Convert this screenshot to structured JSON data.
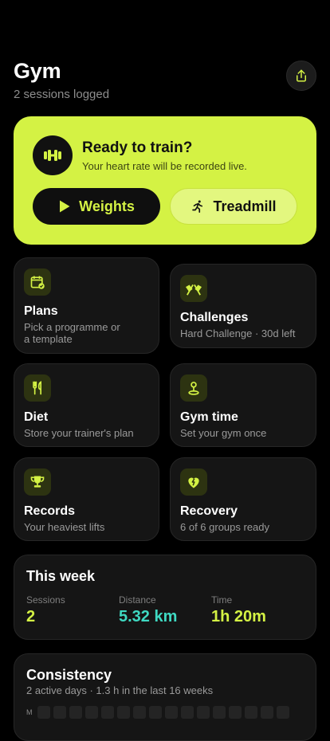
{
  "header": {
    "title": "Gym",
    "subtitle": "2 sessions logged",
    "share_icon": "share-icon"
  },
  "hero": {
    "icon": "dumbbell-icon",
    "title": "Ready to train?",
    "subtitle": "Your heart rate will be recorded live.",
    "weights_label": "Weights",
    "treadmill_label": "Treadmill"
  },
  "tiles": {
    "plans": {
      "title": "Plans",
      "subtitle_line1": "Pick a programme or",
      "subtitle_line2": "a template",
      "icon": "calendar-check-icon"
    },
    "challenges": {
      "title": "Challenges",
      "subtitle": "Hard Challenge · 30d left",
      "icon": "flags-icon"
    },
    "diet": {
      "title": "Diet",
      "subtitle": "Store your trainer's plan",
      "icon": "utensils-icon"
    },
    "gymtime": {
      "title": "Gym time",
      "subtitle": "Set your gym once",
      "icon": "location-pin-icon"
    },
    "records": {
      "title": "Records",
      "subtitle": "Your heaviest lifts",
      "icon": "trophy-icon"
    },
    "recovery": {
      "title": "Recovery",
      "subtitle": "6 of 6 groups ready",
      "icon": "heart-bolt-icon"
    }
  },
  "week": {
    "title": "This week",
    "stats": [
      {
        "label": "Sessions",
        "value": "2",
        "color": "#d4f244"
      },
      {
        "label": "Distance",
        "value": "5.32 km",
        "color": "#3fd9c2"
      },
      {
        "label": "Time",
        "value": "1h 20m",
        "color": "#d4f244"
      }
    ]
  },
  "consistency": {
    "title": "Consistency",
    "subtitle": "2 active days · 1.3 h in the last 16 weeks",
    "row_label": "M"
  },
  "colors": {
    "accent": "#d4f244",
    "teal": "#3fd9c2",
    "background": "#000000",
    "card": "#151515"
  }
}
